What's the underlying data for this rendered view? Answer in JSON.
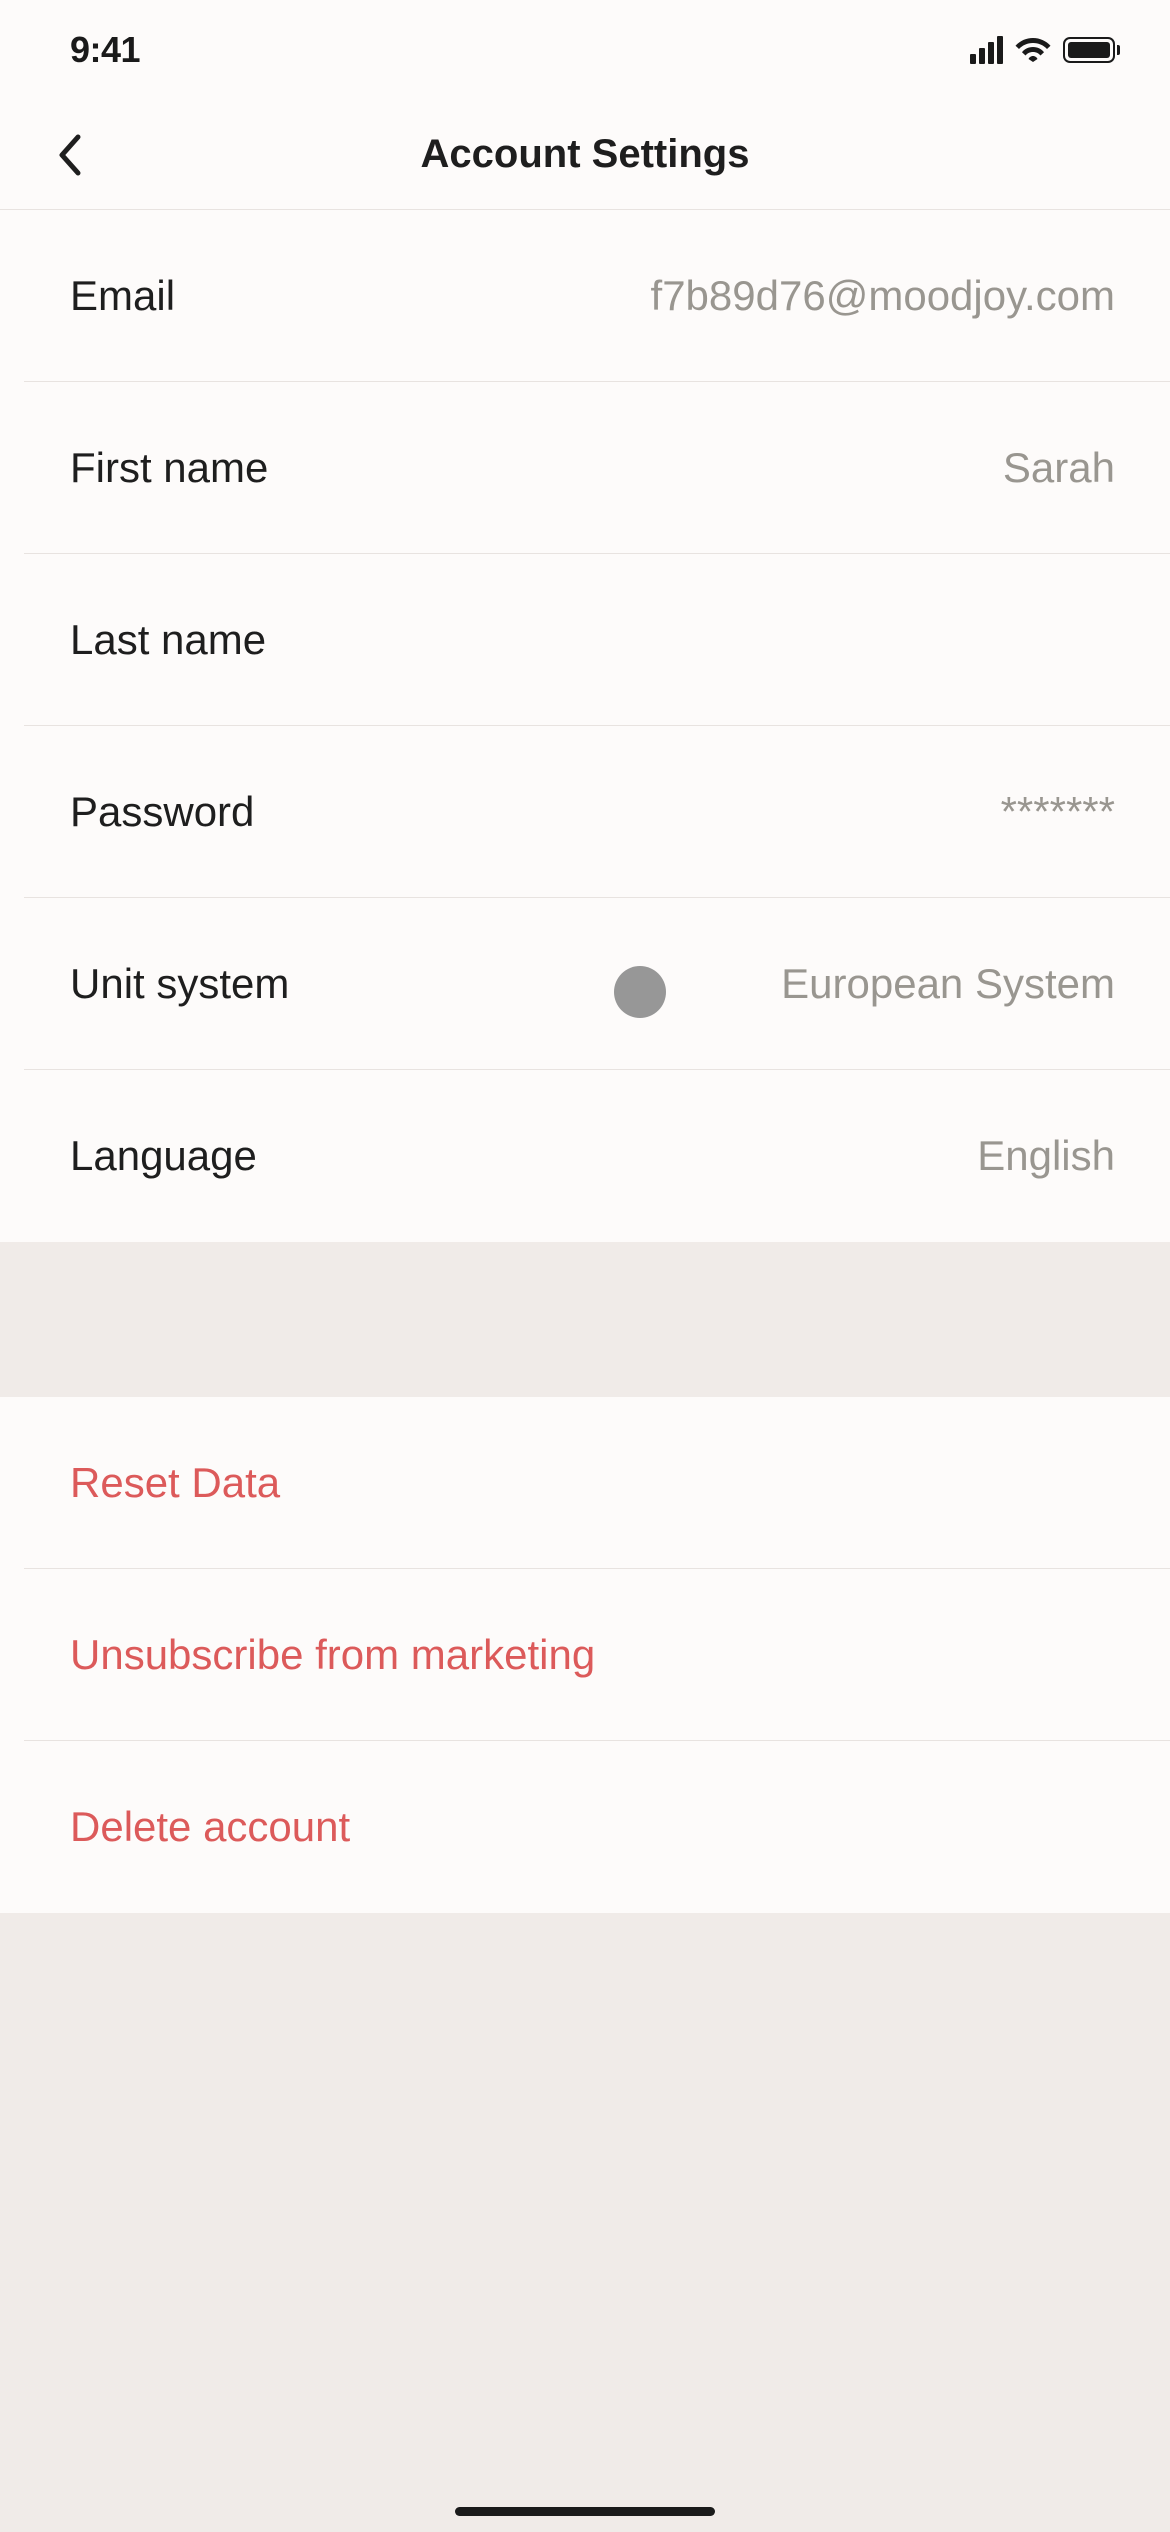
{
  "statusBar": {
    "time": "9:41"
  },
  "header": {
    "title": "Account Settings"
  },
  "settings": {
    "email": {
      "label": "Email",
      "value": "f7b89d76@moodjoy.com"
    },
    "firstName": {
      "label": "First name",
      "value": "Sarah"
    },
    "lastName": {
      "label": "Last name",
      "value": ""
    },
    "password": {
      "label": "Password",
      "value": "*******"
    },
    "unitSystem": {
      "label": "Unit system",
      "value": "European System"
    },
    "language": {
      "label": "Language",
      "value": "English"
    }
  },
  "actions": {
    "resetData": "Reset Data",
    "unsubscribe": "Unsubscribe from marketing",
    "deleteAccount": "Delete account"
  }
}
